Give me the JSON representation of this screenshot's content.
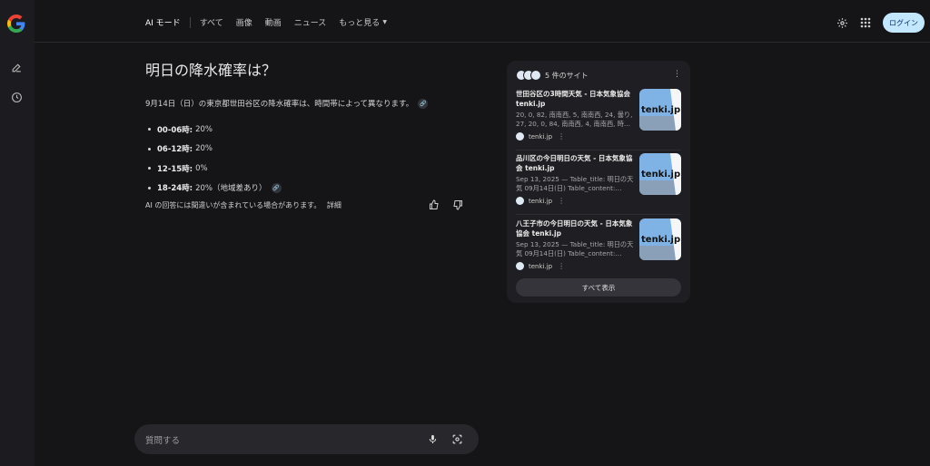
{
  "rail": {
    "logo": "google-g-logo",
    "items": [
      {
        "icon": "new-chat-icon"
      },
      {
        "icon": "history-icon"
      }
    ]
  },
  "nav": {
    "tabs": [
      {
        "label": "AI モード",
        "active": true
      },
      {
        "label": "すべて"
      },
      {
        "label": "画像"
      },
      {
        "label": "動画"
      },
      {
        "label": "ニュース"
      },
      {
        "label": "もっと見る"
      }
    ]
  },
  "header": {
    "settings_icon": "gear-icon",
    "apps_icon": "apps-grid-icon",
    "login_label": "ログイン",
    "login_color": "#c2e7ff"
  },
  "answer": {
    "question": "明日の降水確率は？",
    "summary": "9月14日（日）の東京都世田谷区の降水確率は、時間帯によって異なります。",
    "bullets": [
      {
        "time": "00-06時:",
        "value": "20%"
      },
      {
        "time": "06-12時:",
        "value": "20%"
      },
      {
        "time": "12-15時:",
        "value": "0%"
      },
      {
        "time": "18-24時:",
        "value": "20%（地域差あり）"
      }
    ],
    "disclaimer": "AI の回答には間違いが含まれている場合があります。",
    "details_link": "詳細"
  },
  "sources": {
    "header": "5 件のサイト",
    "items": [
      {
        "title": "世田谷区の3時間天気 - 日本気象協会 tenki.jp",
        "snippet": "20, 0, 82, 南南西, 5, 南南西, 24, 曇り, 27, 20, 0, 84, 南南西, 4, 南南西, 時…",
        "site": "tenki.jp",
        "thumb_text": "tenki.jp"
      },
      {
        "title": "品川区の今日明日の天気 - 日本気象協会 tenki.jp",
        "snippet": "Sep 13, 2025 — Table_title: 明日の天気 09月14日(日) Table_content:…",
        "site": "tenki.jp",
        "thumb_text": "tenki.jp"
      },
      {
        "title": "八王子市の今日明日の天気 - 日本気象協会 tenki.jp",
        "snippet": "Sep 13, 2025 — Table_title: 明日の天気 09月14日(日) Table_content:…",
        "site": "tenki.jp",
        "thumb_text": "tenki.jp"
      }
    ],
    "show_all": "すべて表示"
  },
  "ask": {
    "placeholder": "質問する",
    "mic_icon": "mic-icon",
    "lens_icon": "lens-icon"
  }
}
